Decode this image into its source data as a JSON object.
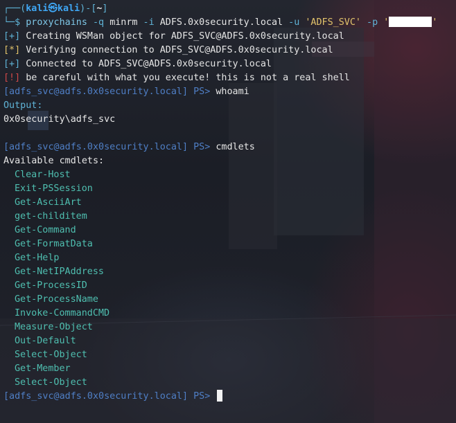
{
  "prompt": {
    "box_top": "┌──(",
    "user_host": "kali㉿kali",
    "box_mid": ")-[",
    "dir": "~",
    "box_end": "]",
    "box_bottom": "└─$ ",
    "cmd": "proxychains",
    "flag_q": " -q ",
    "tool": "minrm",
    "flag_i": " -i ",
    "target": "ADFS.0x0security.local",
    "flag_u": " -u ",
    "username": "'ADFS_SVC'",
    "flag_p": " -p ",
    "password_open": "'",
    "password_close": "'"
  },
  "status": [
    {
      "tag": "[+]",
      "text": " Creating WSMan object for ADFS_SVC@ADFS.0x0security.local"
    },
    {
      "tag": "[*]",
      "text": " Verifying connection to ADFS_SVC@ADFS.0x0security.local"
    },
    {
      "tag": "[+]",
      "text": " Connected to ADFS_SVC@ADFS.0x0security.local"
    },
    {
      "tag": "[!]",
      "text": " be careful with what you execute! this is not a real shell"
    }
  ],
  "ps_prompt": "[adfs_svc@adfs.0x0security.local] PS>",
  "session1": {
    "command": " whoami",
    "output_label": "Output:",
    "output": "0x0security\\adfs_svc"
  },
  "session2": {
    "command": " cmdlets",
    "header": "Available cmdlets:"
  },
  "cmdlets": [
    "Clear-Host",
    "Exit-PSSession",
    "Get-AsciiArt",
    "get-childitem",
    "Get-Command",
    "Get-FormatData",
    "Get-Help",
    "Get-NetIPAddress",
    "Get-ProcessID",
    "Get-ProcessName",
    "Invoke-CommandCMD",
    "Measure-Object",
    "Out-Default",
    "Select-Object",
    "Get-Member",
    "Select-Object"
  ],
  "colors": {
    "info": "#5fb3d6",
    "warn": "#e2c36b",
    "error": "#d04848",
    "prompt": "#4f7fc6",
    "cmdlet": "#4fbfb0"
  }
}
